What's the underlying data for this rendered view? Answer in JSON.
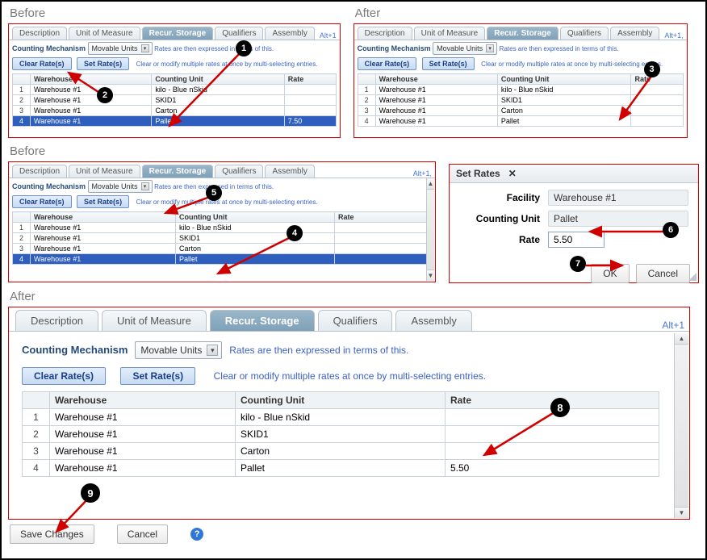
{
  "sections": {
    "before1": "Before",
    "after1": "After",
    "before2": "Before",
    "after2": "After"
  },
  "tabs": [
    "Description",
    "Unit of Measure",
    "Recur. Storage",
    "Qualifiers",
    "Assembly"
  ],
  "tab_shortcut": "Alt+1",
  "tab_shortcut_comma": "Alt+1,",
  "counting_label": "Counting Mechanism",
  "counting_value": "Movable Units",
  "rates_hint": "Rates are then expressed in terms of this.",
  "clear_btn": "Clear Rate(s)",
  "set_btn": "Set Rate(s)",
  "multi_hint": "Clear or modify multiple rates at once by multi-selecting entries.",
  "columns": {
    "warehouse": "Warehouse",
    "unit": "Counting Unit",
    "rate": "Rate"
  },
  "rows": [
    {
      "n": "1",
      "warehouse": "Warehouse #1",
      "unit": "kilo - Blue nSkid",
      "rate": ""
    },
    {
      "n": "2",
      "warehouse": "Warehouse #1",
      "unit": "SKID1",
      "rate": ""
    },
    {
      "n": "3",
      "warehouse": "Warehouse #1",
      "unit": "Carton",
      "rate": ""
    },
    {
      "n": "4",
      "warehouse": "Warehouse #1",
      "unit": "Pallet",
      "rate": ""
    }
  ],
  "before1_rate4": "7.50",
  "after2_rate4": "5.50",
  "dialog": {
    "title": "Set Rates",
    "facility_lbl": "Facility",
    "facility_val": "Warehouse #1",
    "unit_lbl": "Counting Unit",
    "unit_val": "Pallet",
    "rate_lbl": "Rate",
    "rate_val": "5.50",
    "ok": "OK",
    "cancel": "Cancel"
  },
  "footer": {
    "save": "Save Changes",
    "cancel": "Cancel",
    "help": "?"
  },
  "callouts": [
    "1",
    "2",
    "3",
    "4",
    "5",
    "6",
    "7",
    "8",
    "9"
  ]
}
